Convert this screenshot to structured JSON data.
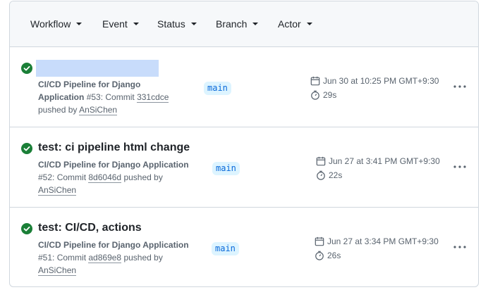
{
  "filters": {
    "workflow": "Workflow",
    "event": "Event",
    "status": "Status",
    "branch": "Branch",
    "actor": "Actor"
  },
  "runs": [
    {
      "title": "",
      "workflow_name": "CI/CD Pipeline for Django Application",
      "workflow_name_line1": "CI/CD Pipeline for Django",
      "workflow_name_line2": "Application",
      "run_number": "#53",
      "commit_prefix": ": Commit",
      "commit": "331cdce",
      "pushed_by": "pushed by",
      "actor": "AnSiChen",
      "branch": "main",
      "date": "Jun 30 at 10:25 PM GMT+9:30",
      "duration": "29s",
      "status": "success"
    },
    {
      "title": "test: ci pipeline html change",
      "workflow_name": "CI/CD Pipeline for Django Application",
      "run_number": "#52",
      "commit_prefix": ": Commit",
      "commit": "8d6046d",
      "pushed_by": "pushed by",
      "actor": "AnSiChen",
      "branch": "main",
      "date": "Jun 27 at 3:41 PM GMT+9:30",
      "duration": "22s",
      "status": "success"
    },
    {
      "title": "test: CI/CD, actions",
      "workflow_name": "CI/CD Pipeline for Django Application",
      "run_number": "#51",
      "commit_prefix": ": Commit",
      "commit": "ad869e8",
      "pushed_by": "pushed by",
      "actor": "AnSiChen",
      "branch": "main",
      "date": "Jun 27 at 3:34 PM GMT+9:30",
      "duration": "26s",
      "status": "success"
    }
  ],
  "colors": {
    "success": "#1a7f37",
    "branch_text": "#0969da",
    "branch_bg": "#ddf4ff",
    "redaction": "#c8dcfb"
  }
}
